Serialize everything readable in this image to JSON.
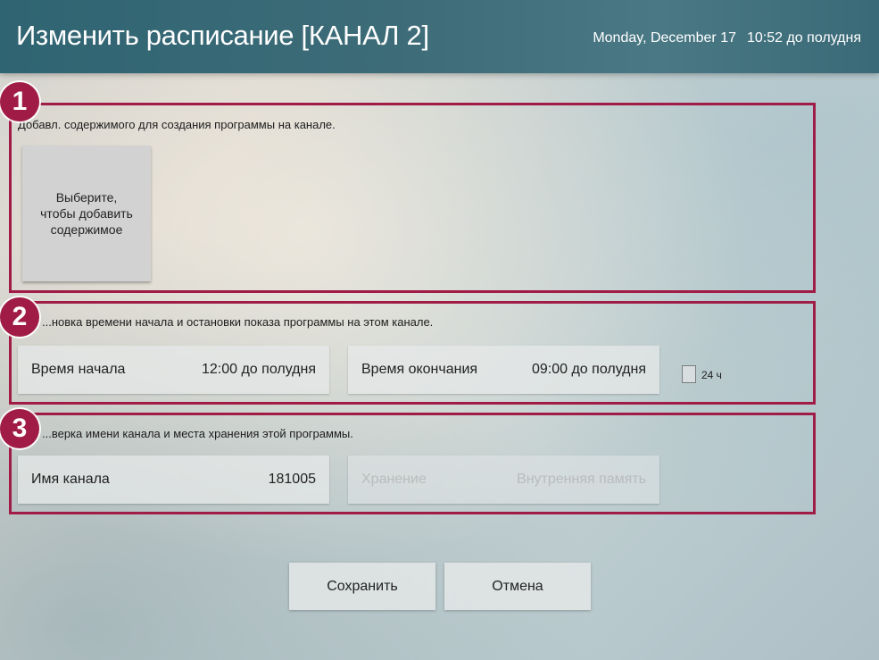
{
  "header": {
    "title": "Изменить расписание [КАНАЛ 2]",
    "date": "Monday, December 17",
    "time": "10:52 до полудня"
  },
  "colors": {
    "header_bg": "#3d6c78",
    "accent": "#a01c46",
    "text": "#222222",
    "disabled_text": "#b8bcbd"
  },
  "sections": {
    "content": {
      "badge": "1",
      "description": "Добавл. содержимого для создания программы на канале.",
      "add_tile_label": "Выберите,\nчтобы добавить\nсодержимое"
    },
    "time": {
      "badge": "2",
      "description": "...новка времени начала и остановки показа программы на этом канале.",
      "start_label": "Время начала",
      "start_value": "12:00 до полудня",
      "end_label": "Время окончания",
      "end_value": "09:00 до полудня",
      "allday_label": "24 ч",
      "allday_checked": false
    },
    "channel": {
      "badge": "3",
      "description": "...верка имени канала и места хранения этой программы.",
      "name_label": "Имя канала",
      "name_value": "181005",
      "storage_label": "Хранение",
      "storage_value": "Внутренняя память"
    }
  },
  "buttons": {
    "save": "Сохранить",
    "cancel": "Отмена"
  }
}
